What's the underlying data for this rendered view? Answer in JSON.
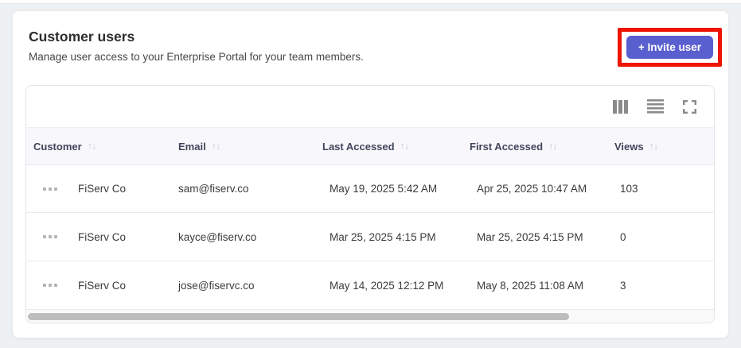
{
  "app": {
    "title": "Customer users",
    "subtitle": "Manage user access to your Enterprise Portal for your team members."
  },
  "actions": {
    "invite_button_label": "+ Invite user"
  },
  "colors": {
    "accent": "#5a5fcf",
    "annotation_highlight": "#ee1400",
    "page_background": "#eef1f3",
    "header_row_background": "#f8f8fc"
  },
  "toolbar": {
    "icons": [
      "columns-icon",
      "density-icon",
      "fullscreen-icon"
    ]
  },
  "table": {
    "sort_glyph": "↑↓",
    "columns": [
      {
        "label": "Customer"
      },
      {
        "label": "Email"
      },
      {
        "label": "Last Accessed"
      },
      {
        "label": "First Accessed"
      },
      {
        "label": "Views"
      }
    ],
    "rows": [
      {
        "customer": "FiServ Co",
        "email": "sam@fiserv.co",
        "last_accessed": "May 19, 2025 5:42 AM",
        "first_accessed": "Apr 25, 2025 10:47 AM",
        "views": "103"
      },
      {
        "customer": "FiServ Co",
        "email": "kayce@fiserv.co",
        "last_accessed": "Mar 25, 2025 4:15 PM",
        "first_accessed": "Mar 25, 2025 4:15 PM",
        "views": "0"
      },
      {
        "customer": "FiServ Co",
        "email": "jose@fiservc.co",
        "last_accessed": "May 14, 2025 12:12 PM",
        "first_accessed": "May 8, 2025 11:08 AM",
        "views": "3"
      }
    ]
  }
}
